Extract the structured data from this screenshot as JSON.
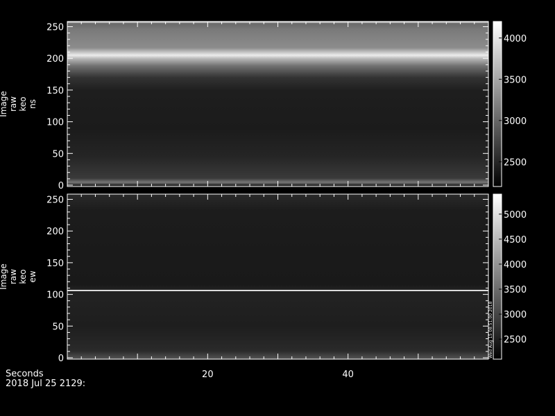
{
  "footer": {
    "seconds_label": "Seconds",
    "date_label": "2018 Jul 25 2129:"
  },
  "chart_data": [
    {
      "type": "heatmap",
      "ylabel_lines": [
        "Image",
        "raw",
        "keo",
        "ns"
      ],
      "x_ticks": [
        "20",
        "40"
      ],
      "xlim": [
        0,
        60
      ],
      "y_ticks": [
        "0",
        "50",
        "100",
        "150",
        "200",
        "250"
      ],
      "ylim": [
        0,
        256
      ],
      "colorbar_ticks": [
        "2500",
        "3000",
        "3500",
        "4000"
      ],
      "colorbar_range": [
        2200,
        4200
      ]
    },
    {
      "type": "heatmap",
      "ylabel_lines": [
        "Image",
        "raw",
        "keo",
        "ew"
      ],
      "x_ticks": [
        "20",
        "40"
      ],
      "xlim": [
        0,
        60
      ],
      "y_ticks": [
        "0",
        "50",
        "100",
        "150",
        "200",
        "250"
      ],
      "ylim": [
        0,
        256
      ],
      "colorbar_ticks": [
        "2500",
        "3000",
        "3500",
        "4000",
        "4500",
        "5000"
      ],
      "colorbar_range": [
        2100,
        5400
      ],
      "side_stamp": "Wed Aug 15 08:51:00 2018"
    }
  ]
}
